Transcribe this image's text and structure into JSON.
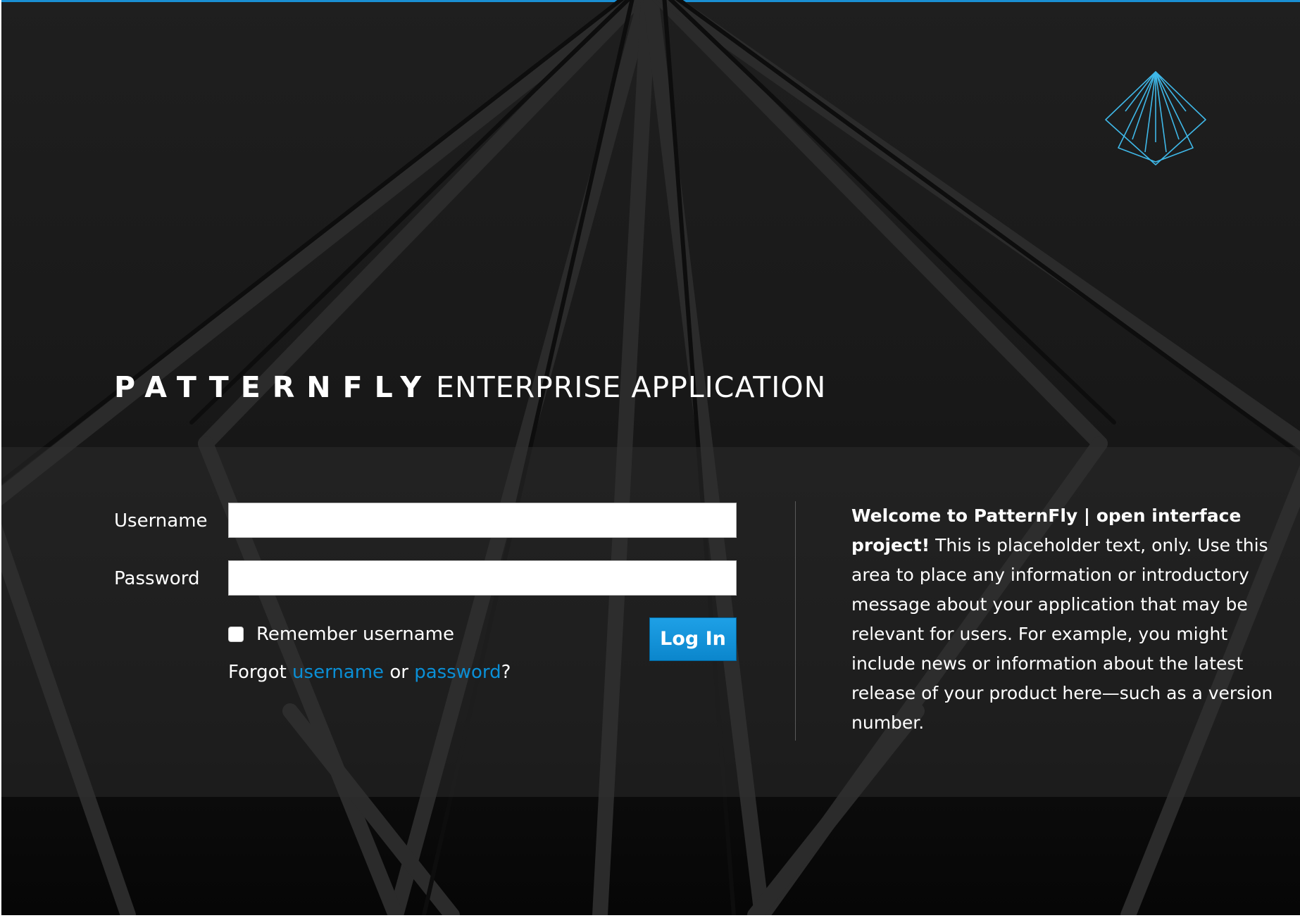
{
  "brand": {
    "name": "PATTERNFLY",
    "subtitle": "ENTERPRISE APPLICATION"
  },
  "login_form": {
    "username_label": "Username",
    "username_value": "",
    "password_label": "Password",
    "password_value": "",
    "remember_label": "Remember username",
    "remember_checked": false,
    "forgot_prefix": "Forgot",
    "forgot_username_link": "username",
    "forgot_or": "or",
    "forgot_password_link": "password",
    "forgot_suffix": "?",
    "login_button_label": "Log In"
  },
  "welcome": {
    "bold_text": "Welcome to PatternFly | open interface project!",
    "body_text": "This is placeholder text, only. Use this area to place any information or introductory message about your application that may be relevant for users. For example, you might include news or information about the latest release of your product here—such as a version number."
  },
  "colors": {
    "accent": "#0a8fd6",
    "top_border": "#1a8fd3",
    "logo_stroke": "#3fb8e8",
    "background": "#1a1a1a",
    "text": "#ffffff"
  },
  "icons": {
    "logo": "patternfly-logo-icon"
  }
}
